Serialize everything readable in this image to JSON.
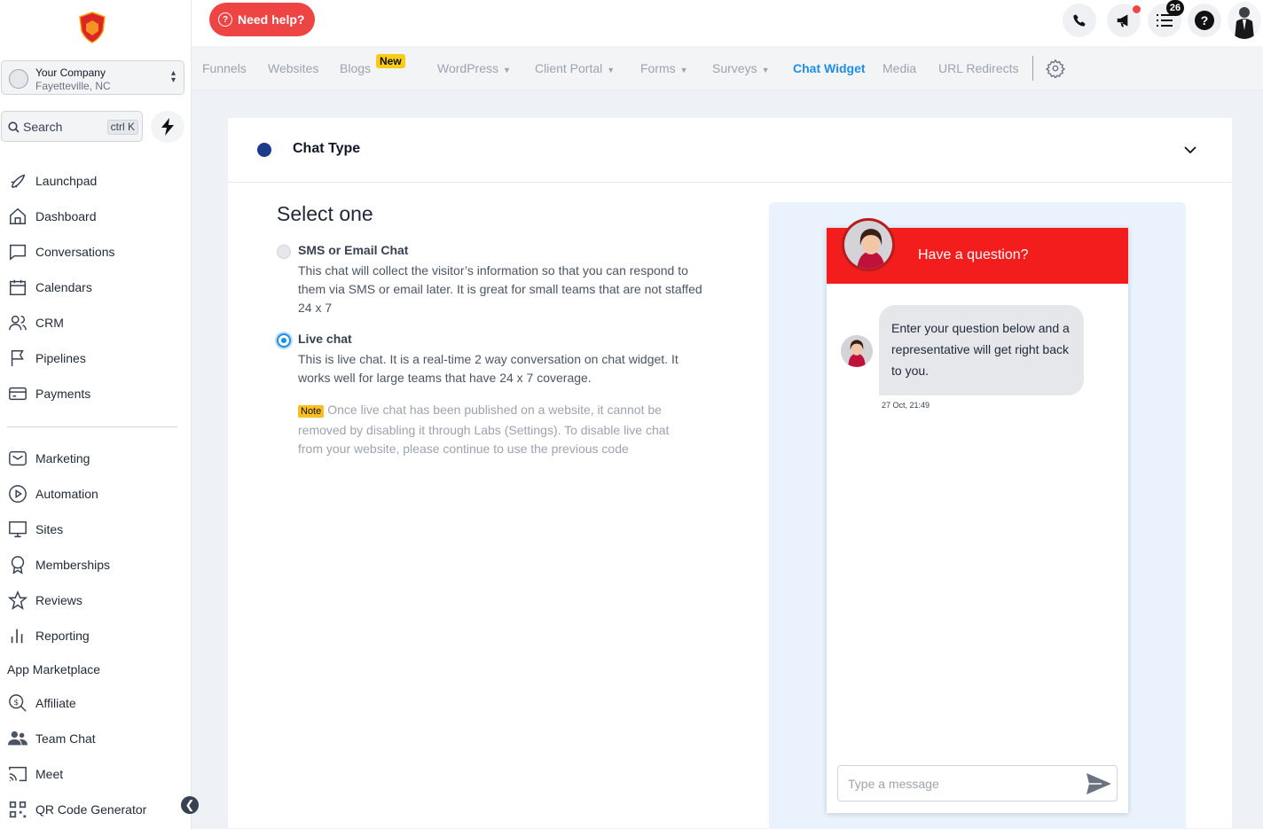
{
  "sidebar": {
    "company_name": "Your Company",
    "company_location": "Fayetteville, NC",
    "search_label": "Search",
    "search_shortcut": "ctrl K",
    "nav_primary": [
      {
        "label": "Launchpad",
        "icon": "rocket-icon"
      },
      {
        "label": "Dashboard",
        "icon": "home-icon"
      },
      {
        "label": "Conversations",
        "icon": "chat-icon"
      },
      {
        "label": "Calendars",
        "icon": "calendar-icon"
      },
      {
        "label": "CRM",
        "icon": "users-icon"
      },
      {
        "label": "Pipelines",
        "icon": "flag-icon"
      },
      {
        "label": "Payments",
        "icon": "credit-card-icon"
      }
    ],
    "nav_secondary": [
      {
        "label": "Marketing",
        "icon": "mail-icon"
      },
      {
        "label": "Automation",
        "icon": "play-circle-icon"
      },
      {
        "label": "Sites",
        "icon": "monitor-icon"
      },
      {
        "label": "Memberships",
        "icon": "award-icon"
      },
      {
        "label": "Reviews",
        "icon": "star-icon"
      },
      {
        "label": "Reporting",
        "icon": "bar-chart-icon"
      },
      {
        "label": "App Marketplace",
        "icon": ""
      },
      {
        "label": "Affiliate",
        "icon": "dollar-search-icon"
      },
      {
        "label": "Team Chat",
        "icon": "team-icon"
      },
      {
        "label": "Meet",
        "icon": "cast-icon"
      },
      {
        "label": "QR Code Generator",
        "icon": "qr-code-icon"
      }
    ]
  },
  "topbar": {
    "help_label": "Need help?",
    "notification_count": "26",
    "help_icon_text": "?"
  },
  "subnav": {
    "items": [
      "Funnels",
      "Websites",
      "Blogs",
      "WordPress",
      "Client Portal",
      "Forms",
      "Surveys",
      "Chat Widget",
      "Media",
      "URL Redirects"
    ],
    "new_badge": "New",
    "active": "Chat Widget"
  },
  "card": {
    "title": "Chat Type",
    "select_label": "Select one",
    "options": [
      {
        "title": "SMS or Email Chat",
        "description": "This chat will collect the visitor’s information so that you can respond to them via SMS or email later. It is great for small teams that are not staffed 24 x 7",
        "selected": false
      },
      {
        "title": "Live chat",
        "description": "This is live chat. It is a real-time 2 way conversation on chat widget. It works well for large teams that have 24 x 7 coverage.",
        "selected": true
      }
    ],
    "note_badge": "Note",
    "note_text": "Once live chat has been published on a website, it cannot be removed by disabling it through Labs (Settings). To disable live chat from your website, please continue to use the previous code"
  },
  "widget": {
    "header_title": "Have a question?",
    "message": "Enter your question below and a representative will get right back to you.",
    "timestamp": "27 Oct, 21:49",
    "input_placeholder": "Type a message"
  },
  "colors": {
    "accent": "#1d8ee6",
    "help_red": "#ef4444",
    "widget_red": "#f31d1d",
    "new_badge": "#facc15"
  }
}
